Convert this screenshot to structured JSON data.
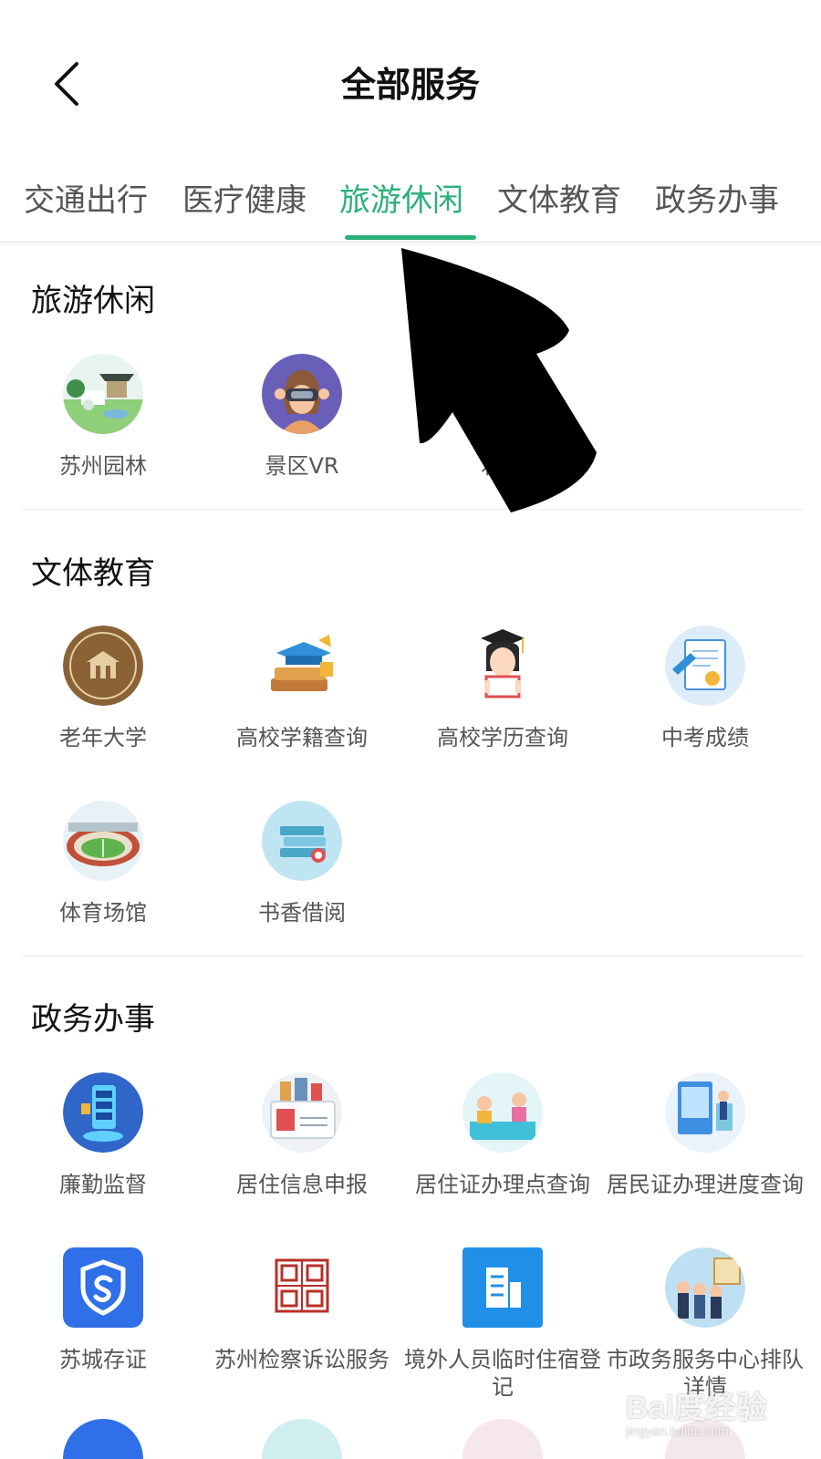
{
  "header": {
    "title": "全部服务"
  },
  "tabs": [
    {
      "label": "交通出行"
    },
    {
      "label": "医疗健康"
    },
    {
      "label": "旅游休闲",
      "active": true
    },
    {
      "label": "文体教育"
    },
    {
      "label": "政务办事"
    }
  ],
  "sections": [
    {
      "title": "旅游休闲",
      "items": [
        {
          "label": "苏州园林",
          "icon": "garden-icon"
        },
        {
          "label": "景区VR",
          "icon": "vr-headset-icon"
        },
        {
          "label": "君生",
          "icon": "obscured-icon"
        }
      ]
    },
    {
      "title": "文体教育",
      "items": [
        {
          "label": "老年大学",
          "icon": "university-seal-icon"
        },
        {
          "label": "高校学籍查询",
          "icon": "graduation-cap-books-icon"
        },
        {
          "label": "高校学历查询",
          "icon": "graduate-student-icon"
        },
        {
          "label": "中考成绩",
          "icon": "certificate-icon"
        },
        {
          "label": "体育场馆",
          "icon": "stadium-icon"
        },
        {
          "label": "书香借阅",
          "icon": "books-icon"
        }
      ]
    },
    {
      "title": "政务办事",
      "items": [
        {
          "label": "廉勤监督",
          "icon": "phone-badge-icon"
        },
        {
          "label": "居住信息申报",
          "icon": "residence-permit-icon"
        },
        {
          "label": "居住证办理点查询",
          "icon": "service-counter-icon"
        },
        {
          "label": "居民证办理进度查询",
          "icon": "progress-terminal-icon"
        },
        {
          "label": "苏城存证",
          "icon": "shield-icon"
        },
        {
          "label": "苏州检察诉讼服务",
          "icon": "procuratorate-seal-icon"
        },
        {
          "label": "境外人员临时住宿登记",
          "icon": "building-icon"
        },
        {
          "label": "市政务服务中心排队详情",
          "icon": "queue-details-icon"
        }
      ]
    }
  ],
  "watermark": {
    "main": "Bai度经验",
    "sub": "jingyan.baidu.com"
  },
  "colors": {
    "accent": "#2bb07a",
    "text": "#555555",
    "title": "#111111"
  }
}
